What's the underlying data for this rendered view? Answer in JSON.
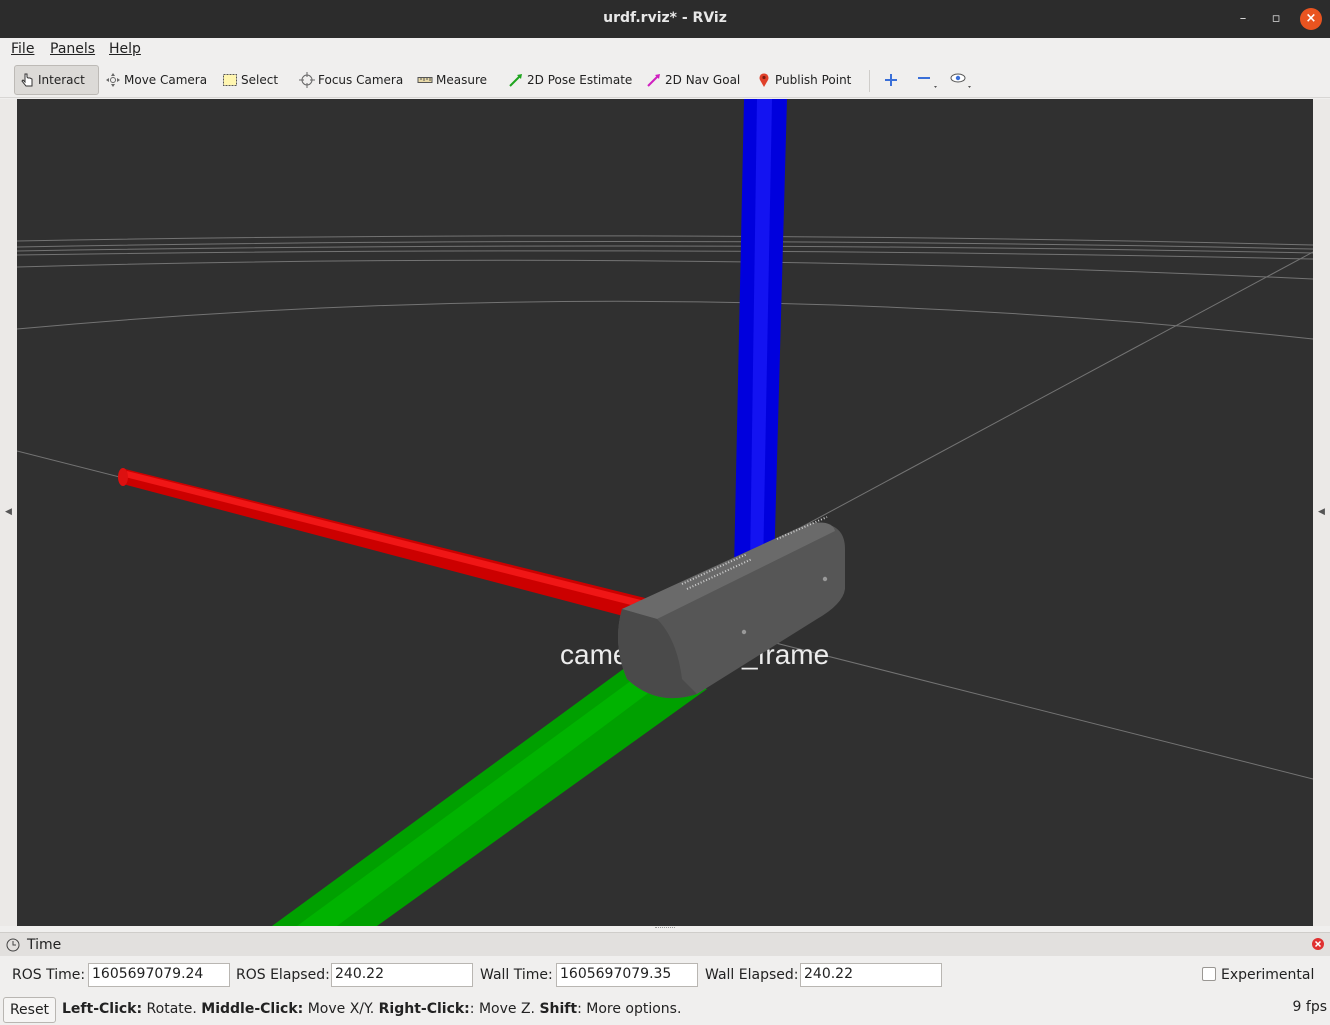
{
  "window": {
    "title": "urdf.rviz* - RViz",
    "minimize_label": "–",
    "maximize_label": "▫",
    "close_label": "×"
  },
  "menu": {
    "items": [
      {
        "label": "File"
      },
      {
        "label": "Panels"
      },
      {
        "label": "Help"
      }
    ]
  },
  "toolbar": {
    "tools": [
      {
        "label": "Interact",
        "active": true,
        "icon": "hand-pointer-icon"
      },
      {
        "label": "Move Camera",
        "icon": "move-camera-icon"
      },
      {
        "label": "Select",
        "icon": "select-rect-icon"
      },
      {
        "label": "Focus Camera",
        "icon": "focus-target-icon"
      },
      {
        "label": "Measure",
        "icon": "ruler-icon"
      },
      {
        "label": "2D Pose Estimate",
        "icon": "green-arrow-icon"
      },
      {
        "label": "2D Nav Goal",
        "icon": "magenta-arrow-icon"
      },
      {
        "label": "Publish Point",
        "icon": "map-pin-icon"
      }
    ],
    "extra_icons": [
      "add-tool-icon",
      "remove-tool-icon",
      "view-eye-icon"
    ]
  },
  "viewport": {
    "frame_label": "camera_screw_frame",
    "background": "#303030",
    "axis_colors": {
      "x": "#e00000",
      "y": "#00b000",
      "z": "#0000e0"
    }
  },
  "time_panel": {
    "title": "Time",
    "ros_time_label": "ROS Time:",
    "ros_time_value": "1605697079.24",
    "ros_elapsed_label": "ROS Elapsed:",
    "ros_elapsed_value": "240.22",
    "wall_time_label": "Wall Time:",
    "wall_time_value": "1605697079.35",
    "wall_elapsed_label": "Wall Elapsed:",
    "wall_elapsed_value": "240.22",
    "experimental_label": "Experimental"
  },
  "status": {
    "reset_label": "Reset",
    "help_parts": [
      {
        "bold": "Left-Click:",
        "text": " Rotate. "
      },
      {
        "bold": "Middle-Click:",
        "text": " Move X/Y. "
      },
      {
        "bold": "Right-Click:",
        "text": ": Move Z. "
      },
      {
        "bold": "Shift",
        "text": ": More options."
      }
    ],
    "fps": "9 fps"
  }
}
